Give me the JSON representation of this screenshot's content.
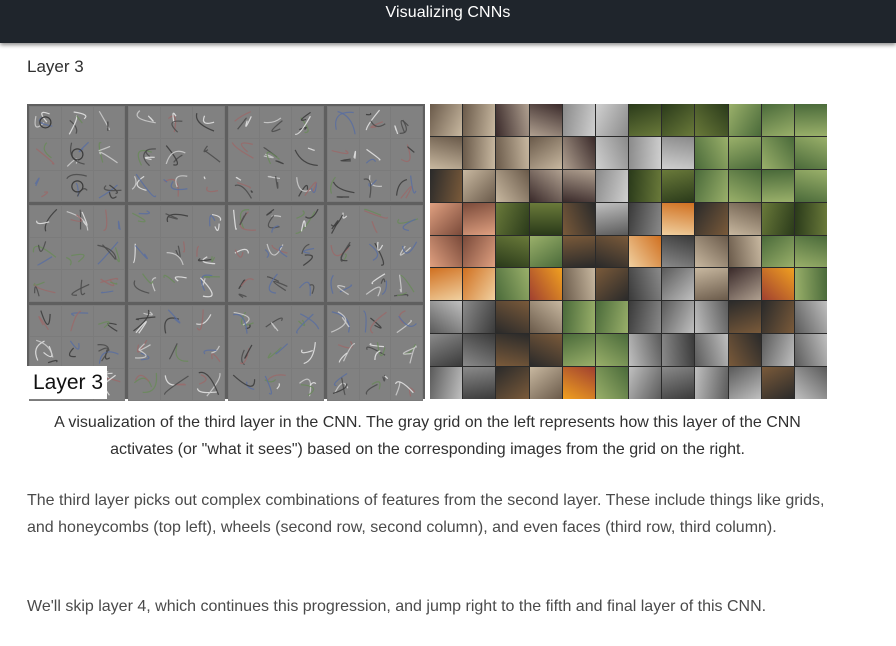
{
  "header": {
    "title": "Visualizing CNNs"
  },
  "section": {
    "title": "Layer 3"
  },
  "figure": {
    "overlay_label": "Layer 3",
    "left_panel_alt": "gray grid of layer 3 activation patterns",
    "right_panel_alt": "grid of image patches that most activate layer 3"
  },
  "caption": "A visualization of the third layer in the CNN. The gray grid on the left represents how this layer of the CNN activates (or \"what it sees\") based on the corresponding images from the grid on the right.",
  "paragraphs": [
    "The third layer picks out complex combinations of features from the second layer. These include things like grids, and honeycombs (top left), wheels (second row, second column), and even faces (third row, third column).",
    "We'll skip layer 4, which continues this progression, and jump right to the fifth and final layer of this CNN."
  ],
  "colors": {
    "topbar": "#1f252c",
    "topbar_text": "#ffffff",
    "body_text": "#4a4a4a",
    "feature_gray": "#818181"
  }
}
